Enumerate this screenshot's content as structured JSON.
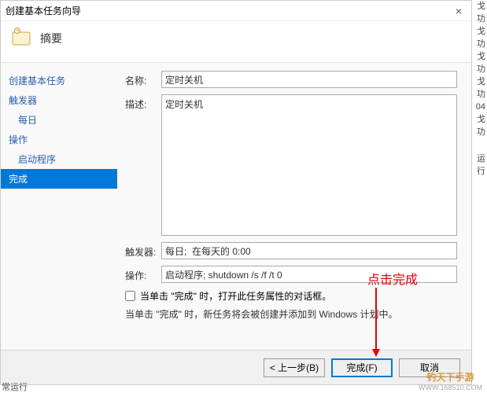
{
  "titlebar": {
    "title": "创建基本任务向导"
  },
  "header": {
    "title": "摘要"
  },
  "sidebar": {
    "steps": [
      {
        "label": "创建基本任务",
        "sub": false,
        "selected": false
      },
      {
        "label": "触发器",
        "sub": false,
        "selected": false
      },
      {
        "label": "每日",
        "sub": true,
        "selected": false
      },
      {
        "label": "操作",
        "sub": false,
        "selected": false
      },
      {
        "label": "启动程序",
        "sub": true,
        "selected": false
      },
      {
        "label": "完成",
        "sub": false,
        "selected": true
      }
    ]
  },
  "form": {
    "name_label": "名称:",
    "name_value": "定时关机",
    "desc_label": "描述:",
    "desc_value": "定时关机",
    "trigger_label": "触发器:",
    "trigger_value": "每日;  在每天的 0:00",
    "action_label": "操作:",
    "action_value": "启动程序; shutdown /s /f /t 0",
    "checkbox_label": "当单击 \"完成\" 时，打开此任务属性的对话框。",
    "note": "当单击 \"完成\" 时，新任务将会被创建并添加到 Windows 计划中。"
  },
  "footer": {
    "back": "< 上一步(B)",
    "finish": "完成(F)",
    "cancel": "取消"
  },
  "annotation": {
    "text": "点击完成"
  },
  "watermark": {
    "brand": "钓天下手游",
    "url": "WWW.168510.COM"
  },
  "bg": {
    "l1": "戈功",
    "l2": "戈功",
    "l3": "戈功",
    "l4": "戈功",
    "l5": "04",
    "l6": "戈功",
    "l7": "运行"
  },
  "status": "常运行"
}
